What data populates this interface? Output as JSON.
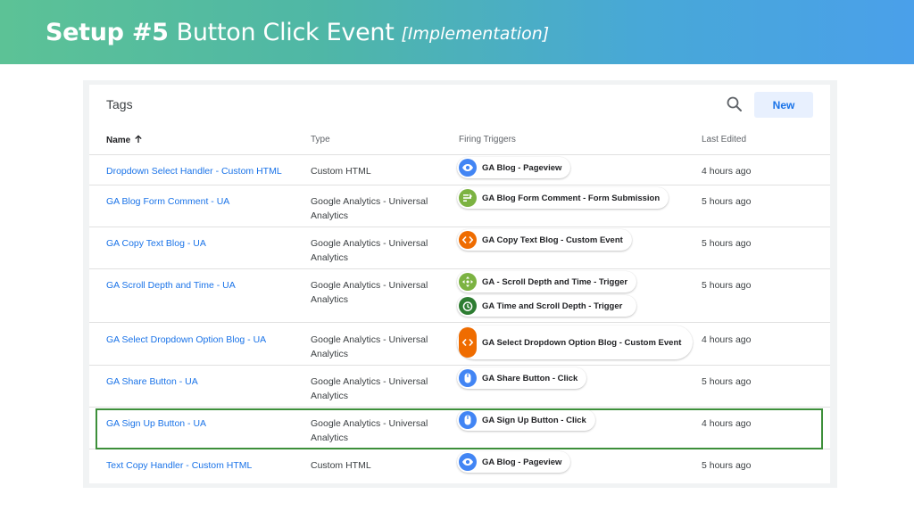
{
  "banner": {
    "bold": "Setup #5",
    "regular": "Button Click Event",
    "italic": "[Implementation]"
  },
  "card": {
    "title": "Tags",
    "new_label": "New",
    "search_icon": "search-icon"
  },
  "columns": {
    "name": "Name",
    "type": "Type",
    "triggers": "Firing Triggers",
    "edited": "Last Edited"
  },
  "colors": {
    "link": "#1a73e8",
    "pageview": "#4285f4",
    "form": "#7cb342",
    "custom_event": "#ef6c00",
    "scroll": "#7cb342",
    "timer": "#2e7d32",
    "click": "#4285f4",
    "highlight": "#3d8f3a"
  },
  "rows": [
    {
      "name": "Dropdown Select Handler - Custom HTML",
      "type": "Custom HTML",
      "edited": "4 hours ago",
      "triggers": [
        {
          "label": "GA Blog - Pageview",
          "icon": "pageview-eye-icon",
          "color": "#4285f4"
        }
      ]
    },
    {
      "name": "GA Blog Form Comment - UA",
      "type": "Google Analytics - Universal Analytics",
      "edited": "5 hours ago",
      "triggers": [
        {
          "label": "GA Blog Form Comment - Form Submission",
          "icon": "form-submission-icon",
          "color": "#7cb342"
        }
      ]
    },
    {
      "name": "GA Copy Text Blog - UA",
      "type": "Google Analytics - Universal Analytics",
      "edited": "5 hours ago",
      "triggers": [
        {
          "label": "GA Copy Text Blog - Custom Event",
          "icon": "custom-event-code-icon",
          "color": "#ef6c00"
        }
      ]
    },
    {
      "name": "GA Scroll Depth and Time - UA",
      "type": "Google Analytics - Universal Analytics",
      "edited": "5 hours ago",
      "triggers": [
        {
          "label": "GA - Scroll Depth and Time - Trigger",
          "icon": "scroll-depth-icon",
          "color": "#7cb342"
        },
        {
          "label": "GA Time and Scroll Depth - Trigger",
          "icon": "timer-clock-icon",
          "color": "#2e7d32"
        }
      ]
    },
    {
      "name": "GA Select Dropdown Option Blog - UA",
      "type": "Google Analytics - Universal Analytics",
      "edited": "4 hours ago",
      "triggers": [
        {
          "label": "GA Select Dropdown Option Blog - Custom Event",
          "icon": "custom-event-code-icon",
          "color": "#ef6c00",
          "tall": true
        }
      ]
    },
    {
      "name": "GA Share Button - UA",
      "type": "Google Analytics - Universal Analytics",
      "edited": "5 hours ago",
      "triggers": [
        {
          "label": "GA Share Button - Click",
          "icon": "click-mouse-icon",
          "color": "#4285f4"
        }
      ]
    },
    {
      "name": "GA Sign Up Button - UA",
      "type": "Google Analytics - Universal Analytics",
      "edited": "4 hours ago",
      "triggers": [
        {
          "label": "GA Sign Up Button - Click",
          "icon": "click-mouse-icon",
          "color": "#4285f4"
        }
      ]
    },
    {
      "name": "Text Copy Handler - Custom HTML",
      "type": "Custom HTML",
      "edited": "5 hours ago",
      "triggers": [
        {
          "label": "GA Blog - Pageview",
          "icon": "pageview-eye-icon",
          "color": "#4285f4"
        }
      ]
    }
  ]
}
